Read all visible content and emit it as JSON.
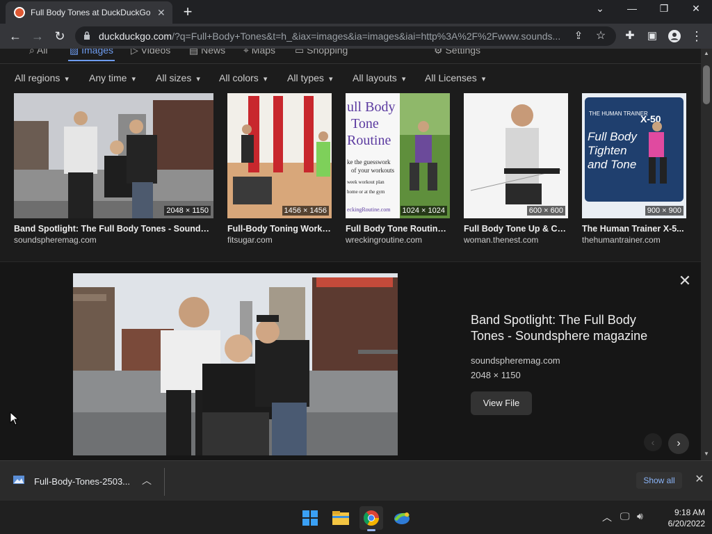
{
  "browser": {
    "tab_title": "Full Body Tones at DuckDuckGo",
    "url_host": "duckduckgo.com",
    "url_rest": "/?q=Full+Body+Tones&t=h_&iax=images&ia=images&iai=http%3A%2F%2Fwww.sounds..."
  },
  "nav": {
    "items": [
      "All",
      "Images",
      "Videos",
      "News",
      "Maps",
      "Shopping"
    ],
    "settings": "Settings"
  },
  "filters": [
    "All regions",
    "Any time",
    "All sizes",
    "All colors",
    "All types",
    "All layouts",
    "All Licenses"
  ],
  "results": [
    {
      "title": "Band Spotlight: The Full Body Tones - Soundsphe...",
      "source": "soundspheremag.com",
      "dims": "2048 × 1150"
    },
    {
      "title": "Full-Body Toning Worko...",
      "source": "fitsugar.com",
      "dims": "1456 × 1456"
    },
    {
      "title": "Full Body Tone Routine ...",
      "source": "wreckingroutine.com",
      "dims": "1024 × 1024",
      "overlay": [
        "ull Body",
        "Tone",
        "Routine",
        "ke the guesswork",
        "of your workouts",
        "week workout plan",
        "home or at the gym",
        "eckingRoutine.com"
      ]
    },
    {
      "title": "Full Body Tone Up & Ca...",
      "source": "woman.thenest.com",
      "dims": "600 × 600"
    },
    {
      "title": "The Human Trainer X-5...",
      "source": "thehumantrainer.com",
      "dims": "900 × 900",
      "overlay": [
        "THE HUMAN TRAINER",
        "X-50",
        "Full Body",
        "Tighten",
        "and Tone"
      ]
    }
  ],
  "detail": {
    "title": "Band Spotlight: The Full Body Tones - Soundsphere magazine",
    "source": "soundspheremag.com",
    "dims": "2048 × 1150",
    "view_file": "View File"
  },
  "downloads": {
    "filename": "Full-Body-Tones-2503...",
    "show_all": "Show all"
  },
  "clock": {
    "time": "9:18 AM",
    "date": "6/20/2022"
  }
}
